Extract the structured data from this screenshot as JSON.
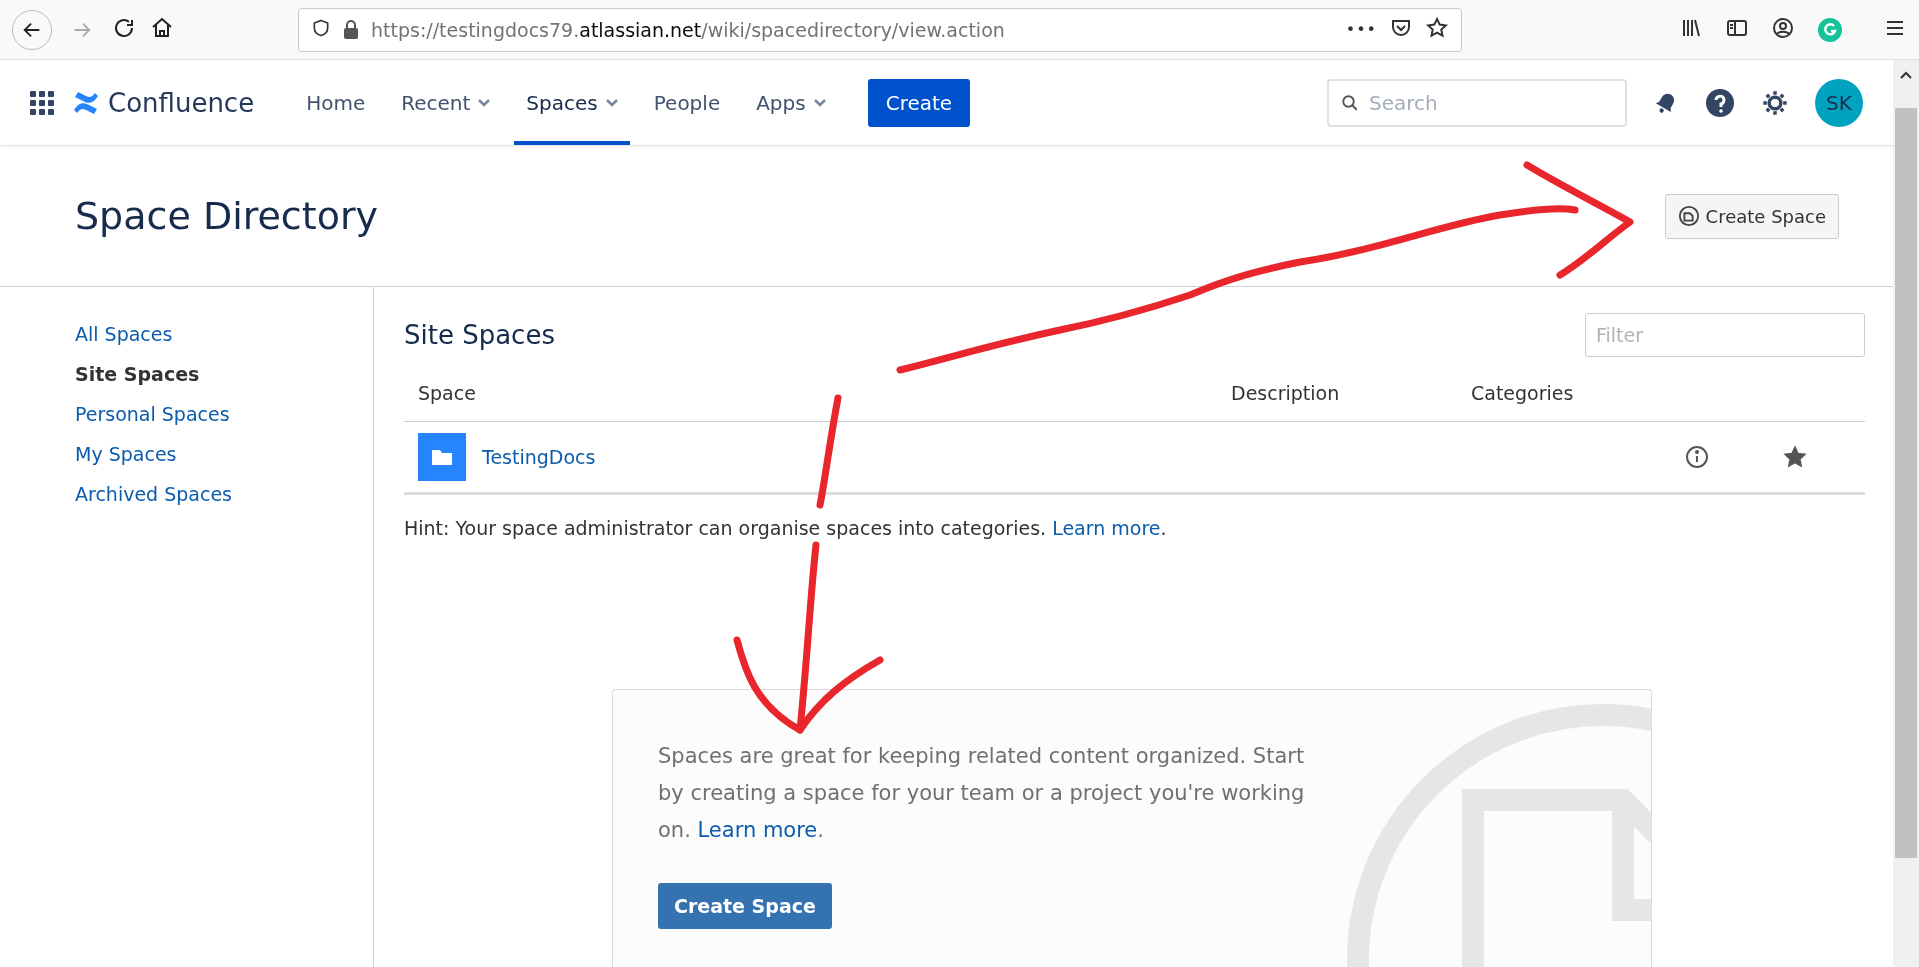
{
  "browser": {
    "url": {
      "prefix": "https://testingdocs79.",
      "domain": "atlassian.net",
      "path": "/wiki/spacedirectory/view.action"
    },
    "overflow": "•••"
  },
  "header": {
    "product": "Confluence",
    "nav": [
      {
        "label": "Home",
        "dropdown": false,
        "selected": false
      },
      {
        "label": "Recent",
        "dropdown": true,
        "selected": false
      },
      {
        "label": "Spaces",
        "dropdown": true,
        "selected": true
      },
      {
        "label": "People",
        "dropdown": false,
        "selected": false
      },
      {
        "label": "Apps",
        "dropdown": true,
        "selected": false
      }
    ],
    "create": "Create",
    "search": {
      "placeholder": "Search"
    },
    "avatar": "SK"
  },
  "page": {
    "title": "Space Directory",
    "create_space": "Create Space"
  },
  "sidebar": {
    "items": [
      {
        "label": "All Spaces",
        "selected": false
      },
      {
        "label": "Site Spaces",
        "selected": true
      },
      {
        "label": "Personal Spaces",
        "selected": false
      },
      {
        "label": "My Spaces",
        "selected": false
      },
      {
        "label": "Archived Spaces",
        "selected": false
      }
    ]
  },
  "section": {
    "title": "Site Spaces",
    "filter": {
      "placeholder": "Filter"
    }
  },
  "table": {
    "columns": [
      "Space",
      "Description",
      "Categories"
    ],
    "rows": [
      {
        "name": "TestingDocs",
        "starred": true
      }
    ]
  },
  "hint": {
    "text": "Hint: Your space administrator can organise spaces into categories. ",
    "link": "Learn more",
    "suffix": "."
  },
  "empty_state": {
    "text": "Spaces are great for keeping related content organized. Start by creating a space for your team or a project you're working on. ",
    "link": "Learn more",
    "suffix": ".",
    "button": "Create Space"
  }
}
